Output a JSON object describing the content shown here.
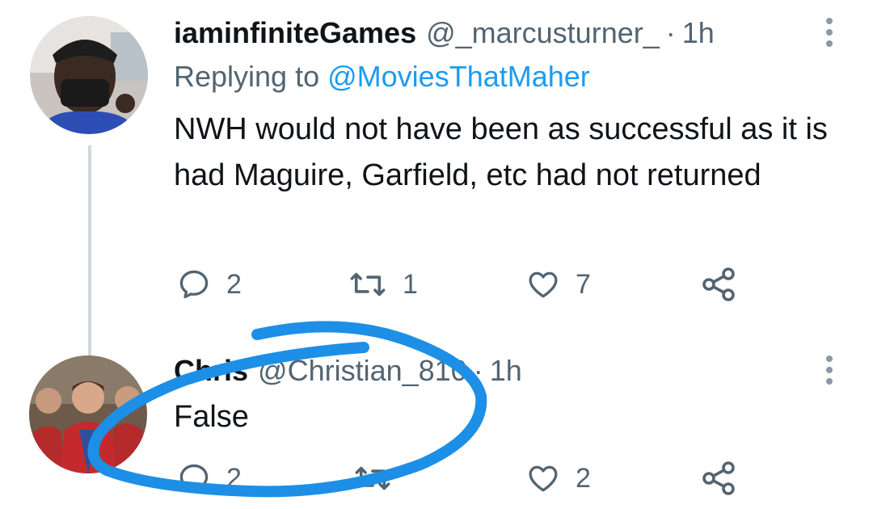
{
  "tweets": [
    {
      "display_name": "iaminfiniteGames",
      "handle": "@_marcusturner_",
      "separator": "·",
      "time": "1h",
      "replying_prefix": "Replying to",
      "replying_to": "@MoviesThatMaher",
      "text": "NWH would not have been as successful as it is had Maguire, Garfield, etc had not returned",
      "reply_count": "2",
      "retweet_count": "1",
      "like_count": "7"
    },
    {
      "display_name": "Chris",
      "handle": "@Christian_810",
      "separator": "·",
      "time": "1h",
      "text": "False",
      "reply_count": "2",
      "retweet_count": "",
      "like_count": "2"
    }
  ],
  "icons": {
    "reply": "reply-bubble-icon",
    "retweet": "retweet-icon",
    "like": "heart-icon",
    "share": "share-icon",
    "more": "more-vertical-icon"
  },
  "colors": {
    "link": "#1d9bf0",
    "secondary_text": "#536471",
    "scribble": "#1d8fe6"
  }
}
